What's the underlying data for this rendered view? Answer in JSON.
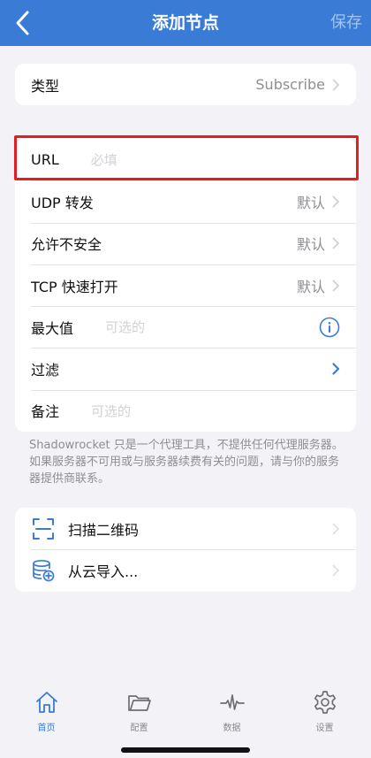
{
  "nav": {
    "title": "添加节点",
    "save_label": "保存"
  },
  "type_row": {
    "label": "类型",
    "value": "Subscribe"
  },
  "form": {
    "url": {
      "label": "URL",
      "placeholder": "必填"
    },
    "udp": {
      "label": "UDP 转发",
      "value": "默认"
    },
    "insecure": {
      "label": "允许不安全",
      "value": "默认"
    },
    "tcp_fast_open": {
      "label": "TCP 快速打开",
      "value": "默认"
    },
    "max_value": {
      "label": "最大值",
      "placeholder": "可选的"
    },
    "filter": {
      "label": "过滤"
    },
    "remark": {
      "label": "备注",
      "placeholder": "可选的"
    }
  },
  "footnote": "Shadowrocket 只是一个代理工具，不提供任何代理服务器。如果服务器不可用或与服务器续费有关的问题，请与你的服务器提供商联系。",
  "actions": {
    "scan_qr": "扫描二维码",
    "import_cloud": "从云导入..."
  },
  "tabs": [
    {
      "label": "首页",
      "icon": "home-icon",
      "active": true
    },
    {
      "label": "配置",
      "icon": "folder-icon",
      "active": false
    },
    {
      "label": "数据",
      "icon": "activity-icon",
      "active": false
    },
    {
      "label": "设置",
      "icon": "gear-icon",
      "active": false
    }
  ],
  "colors": {
    "accent": "#3a7bd5",
    "highlight_box": "#e02020",
    "secondary_text": "#8e8e93",
    "placeholder_text": "#d2d2d6"
  }
}
